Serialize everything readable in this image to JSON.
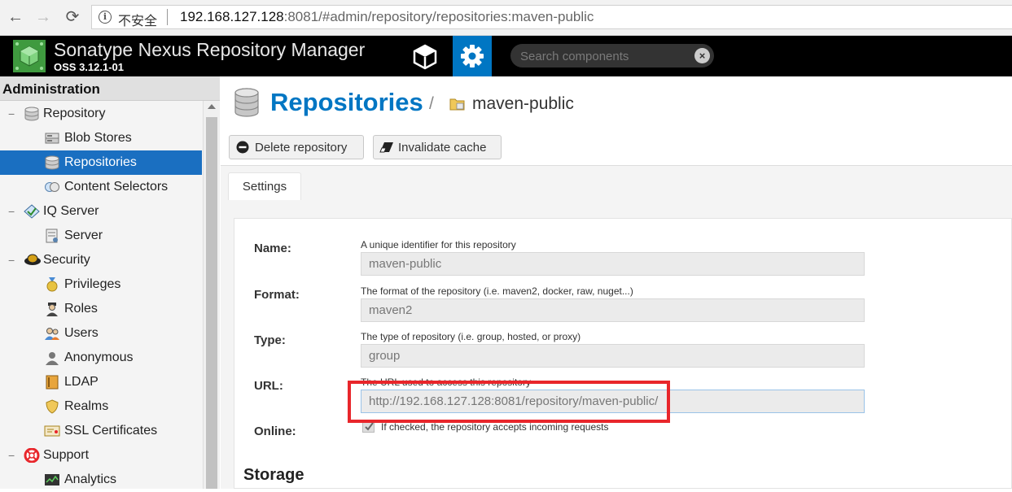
{
  "browser": {
    "insecure_label": "不安全",
    "url_host": "192.168.127.128",
    "url_rest": ":8081/#admin/repository/repositories:maven-public"
  },
  "header": {
    "title": "Sonatype Nexus Repository Manager",
    "version": "OSS 3.12.1-01",
    "search_placeholder": "Search components"
  },
  "sidebar": {
    "title": "Administration",
    "items": [
      {
        "label": "Repository",
        "level": 0,
        "icon": "database-icon"
      },
      {
        "label": "Blob Stores",
        "level": 1,
        "icon": "blob-store-icon"
      },
      {
        "label": "Repositories",
        "level": 1,
        "icon": "database-icon",
        "selected": true
      },
      {
        "label": "Content Selectors",
        "level": 1,
        "icon": "content-selector-icon"
      },
      {
        "label": "IQ Server",
        "level": 0,
        "icon": "iq-server-icon"
      },
      {
        "label": "Server",
        "level": 1,
        "icon": "server-icon"
      },
      {
        "label": "Security",
        "level": 0,
        "icon": "security-icon"
      },
      {
        "label": "Privileges",
        "level": 1,
        "icon": "medal-icon"
      },
      {
        "label": "Roles",
        "level": 1,
        "icon": "role-icon"
      },
      {
        "label": "Users",
        "level": 1,
        "icon": "users-icon"
      },
      {
        "label": "Anonymous",
        "level": 1,
        "icon": "anonymous-icon"
      },
      {
        "label": "LDAP",
        "level": 1,
        "icon": "ldap-icon"
      },
      {
        "label": "Realms",
        "level": 1,
        "icon": "shield-icon"
      },
      {
        "label": "SSL Certificates",
        "level": 1,
        "icon": "certificate-icon"
      },
      {
        "label": "Support",
        "level": 0,
        "icon": "lifebuoy-icon"
      },
      {
        "label": "Analytics",
        "level": 1,
        "icon": "analytics-icon"
      }
    ]
  },
  "main": {
    "title": "Repositories",
    "crumb_sep": "/",
    "crumb": "maven-public",
    "toolbar": {
      "delete_label": "Delete repository",
      "invalidate_label": "Invalidate cache"
    },
    "tab": "Settings",
    "form": {
      "name_label": "Name:",
      "name_help": "A unique identifier for this repository",
      "name_value": "maven-public",
      "format_label": "Format:",
      "format_help": "The format of the repository (i.e. maven2, docker, raw, nuget...)",
      "format_value": "maven2",
      "type_label": "Type:",
      "type_help": "The type of repository (i.e. group, hosted, or proxy)",
      "type_value": "group",
      "url_label": "URL:",
      "url_help": "The URL used to access this repository",
      "url_value": "http://192.168.127.128:8081/repository/maven-public/",
      "online_label": "Online:",
      "online_help": "If checked, the repository accepts incoming requests",
      "online_checked": true
    },
    "storage_title": "Storage"
  },
  "colors": {
    "accent": "#0076c3",
    "selected": "#1a6fc1",
    "highlight": "#e8262b"
  }
}
